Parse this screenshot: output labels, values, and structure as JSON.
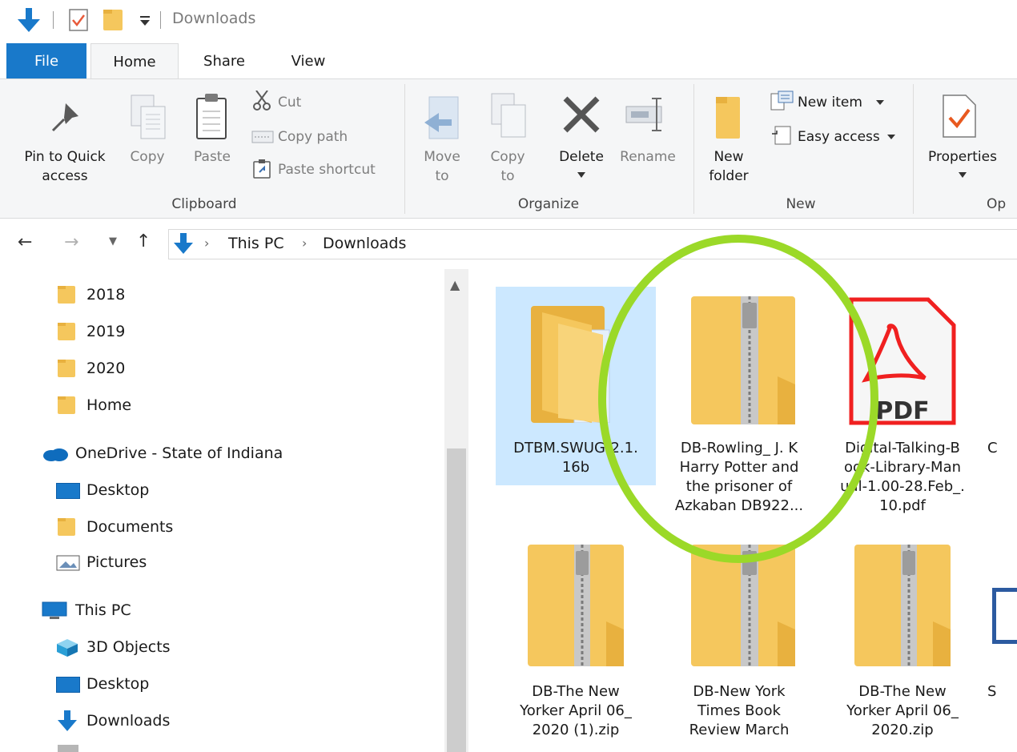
{
  "title_bar": {
    "title": "Downloads"
  },
  "ribbon_tabs": [
    "File",
    "Home",
    "Share",
    "View"
  ],
  "ribbon": {
    "clipboard": {
      "pin_label_1": "Pin to Quick",
      "pin_label_2": "access",
      "copy": "Copy",
      "paste": "Paste",
      "cut": "Cut",
      "copy_path": "Copy path",
      "paste_shortcut": "Paste shortcut",
      "group": "Clipboard"
    },
    "organize": {
      "move_1": "Move",
      "move_2": "to",
      "copy_1": "Copy",
      "copy_2": "to",
      "delete": "Delete",
      "rename": "Rename",
      "group": "Organize"
    },
    "new": {
      "new_folder_1": "New",
      "new_folder_2": "folder",
      "new_item": "New item",
      "easy_access": "Easy access",
      "group": "New"
    },
    "open": {
      "properties": "Properties",
      "group": "Op"
    }
  },
  "address": {
    "crumbs": [
      "This PC",
      "Downloads"
    ]
  },
  "sidebar": {
    "items": [
      "2018",
      "2019",
      "2020",
      "Home",
      "OneDrive - State of Indiana",
      "Desktop",
      "Documents",
      "Pictures",
      "This PC",
      "3D Objects",
      "Desktop",
      "Downloads"
    ]
  },
  "files": [
    {
      "lines": [
        "DTBM.SWUG-2.1.",
        "16b"
      ]
    },
    {
      "lines": [
        "DB-Rowling_ J. K",
        "Harry Potter and",
        "the prisoner of",
        "Azkaban DB922..."
      ]
    },
    {
      "lines": [
        "Digital-Talking-B",
        "ook-Library-Man",
        "ual-1.00-28.Feb_.",
        "10.pdf"
      ]
    },
    {
      "lines": [
        "C"
      ]
    },
    {
      "lines": [
        "DB-The New",
        "Yorker April 06_",
        "2020 (1).zip"
      ]
    },
    {
      "lines": [
        "DB-New York",
        "Times Book",
        "Review March"
      ]
    },
    {
      "lines": [
        "DB-The New",
        "Yorker April 06_",
        "2020.zip"
      ]
    },
    {
      "lines": [
        "S"
      ]
    }
  ],
  "pdf_icon_text": "PDF",
  "colors": {
    "accent": "#1979ca",
    "folder": "#f5c75d",
    "annotation": "#9bd928",
    "selection": "#cce8ff"
  }
}
